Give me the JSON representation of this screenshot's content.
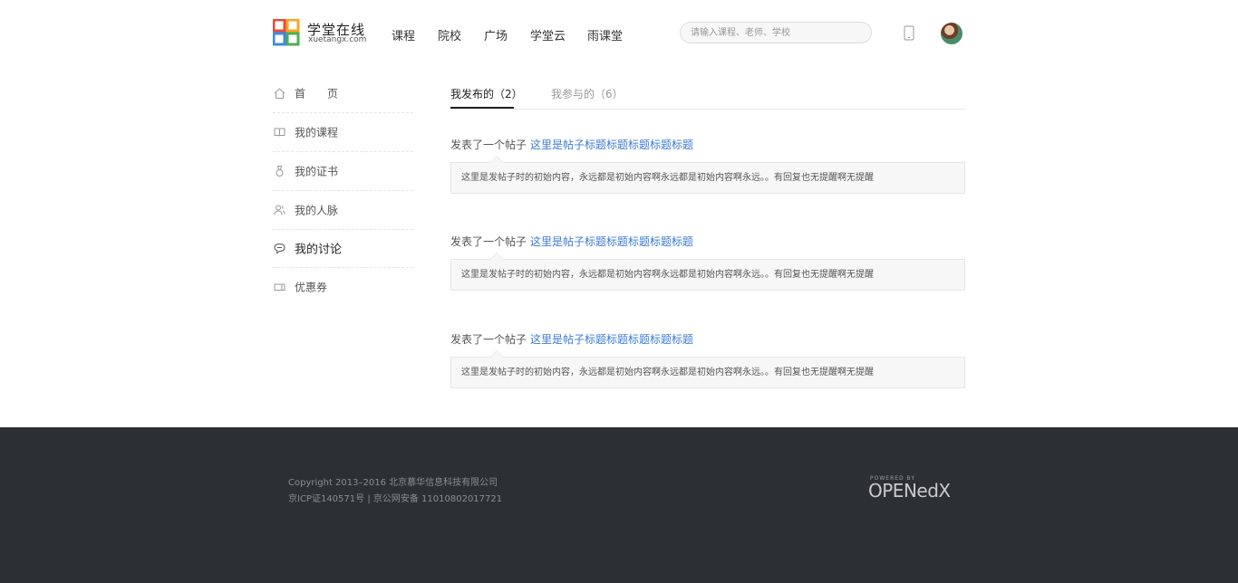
{
  "header": {
    "logo_text": "学堂在线",
    "logo_sub": "xuetangx.com",
    "nav": [
      "课程",
      "院校",
      "广场",
      "学堂云",
      "雨课堂"
    ],
    "search_placeholder": "请输入课程、老师、学校"
  },
  "sidebar": {
    "items": [
      {
        "label": "首　　页",
        "icon": "home-icon"
      },
      {
        "label": "我的课程",
        "icon": "book-icon"
      },
      {
        "label": "我的证书",
        "icon": "medal-icon"
      },
      {
        "label": "我的人脉",
        "icon": "people-icon"
      },
      {
        "label": "我的讨论",
        "icon": "chat-icon",
        "active": true
      },
      {
        "label": "优惠券",
        "icon": "coupon-icon"
      }
    ]
  },
  "tabs": [
    {
      "label": "我发布的（2）",
      "active": true
    },
    {
      "label": "我参与的（6）",
      "active": false
    }
  ],
  "posts": [
    {
      "action": "发表了一个帖子",
      "title": "这里是帖子标题标题标题标题标题",
      "content": "这里是发帖子时的初始内容，永远都是初始内容啊永远都是初始内容啊永远。。有回复也无提醒啊无提醒"
    },
    {
      "action": "发表了一个帖子",
      "title": "这里是帖子标题标题标题标题标题",
      "content": "这里是发帖子时的初始内容，永远都是初始内容啊永远都是初始内容啊永远。。有回复也无提醒啊无提醒"
    },
    {
      "action": "发表了一个帖子",
      "title": "这里是帖子标题标题标题标题标题",
      "content": "这里是发帖子时的初始内容，永远都是初始内容啊永远都是初始内容啊永远。。有回复也无提醒啊无提醒"
    }
  ],
  "footer": {
    "copyright": "Copyright 2013–2016 北京慕华信息科技有限公司",
    "icp": "京ICP证140571号 | 京公网安备 11010802017721",
    "powered_by": "POWERED BY",
    "openedx": "OPENedX"
  },
  "colors": {
    "link": "#3a7bd5",
    "footer_bg": "#2c2f33"
  }
}
